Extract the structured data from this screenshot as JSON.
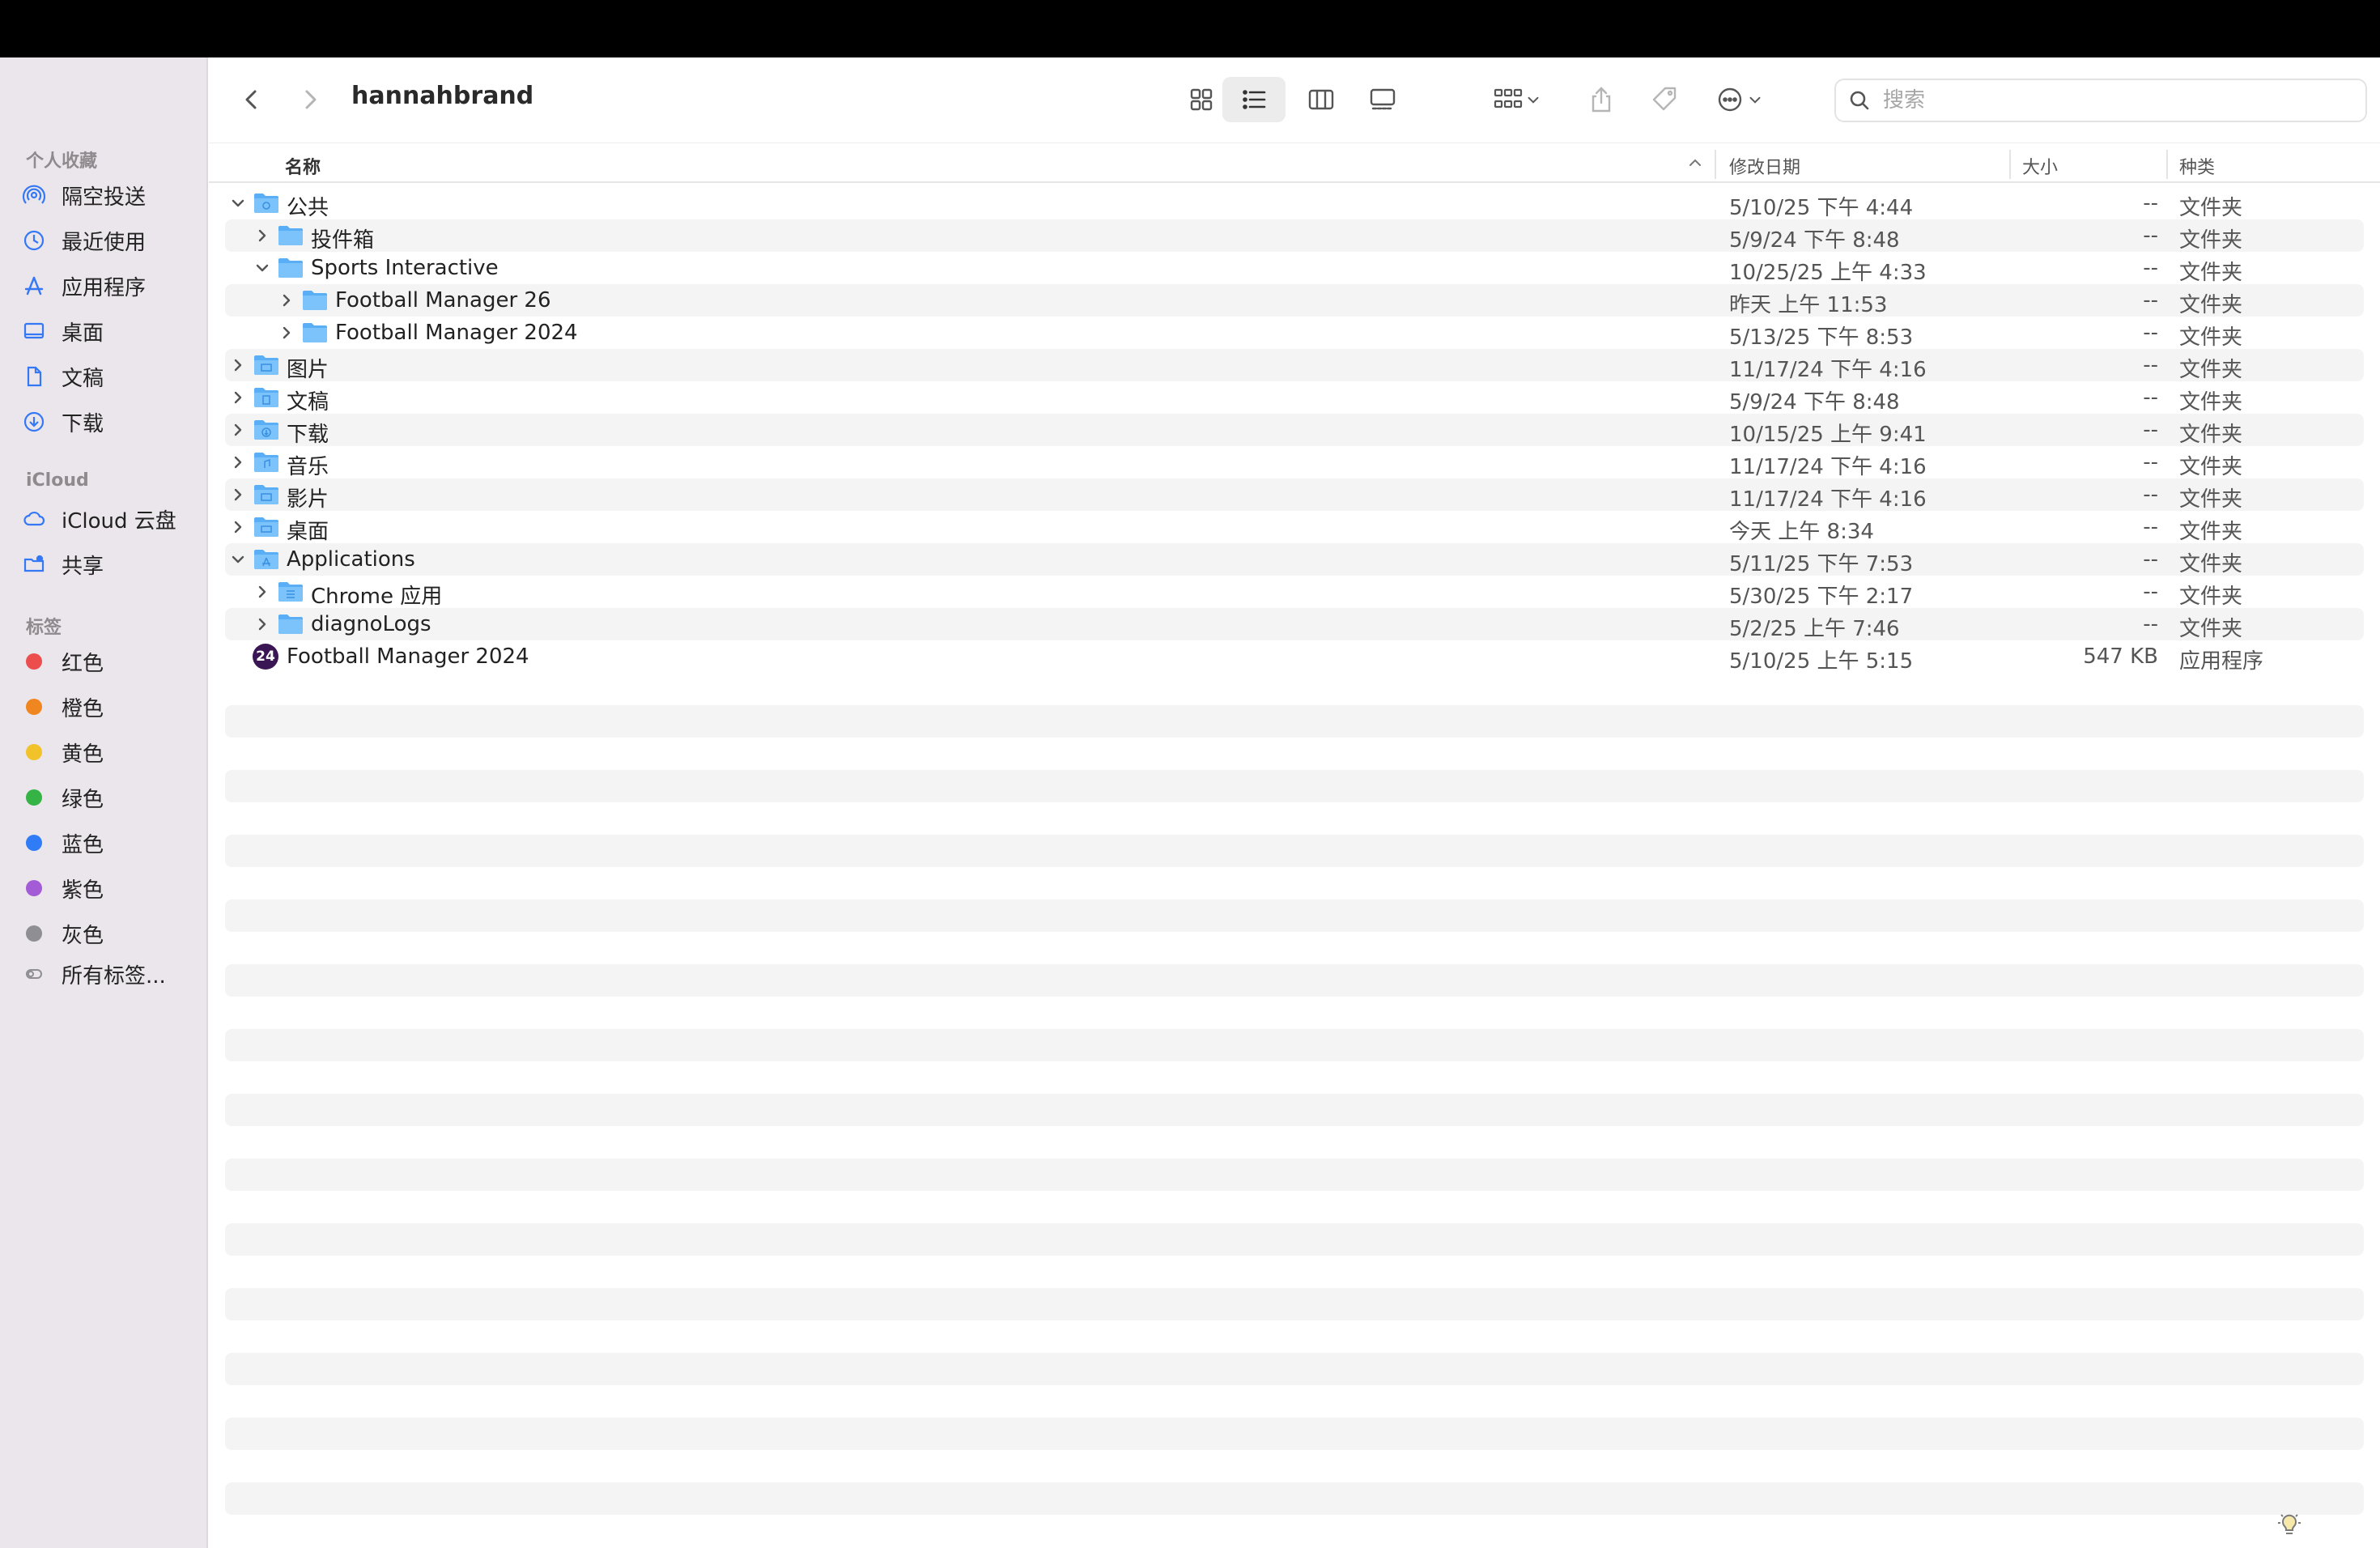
{
  "toolbar": {
    "title": "hannahbrand",
    "search_placeholder": "搜索"
  },
  "sidebar": {
    "favorites_header": "个人收藏",
    "favorites": [
      {
        "label": "隔空投送",
        "icon": "airdrop-icon"
      },
      {
        "label": "最近使用",
        "icon": "recents-clock-icon"
      },
      {
        "label": "应用程序",
        "icon": "applications-icon"
      },
      {
        "label": "桌面",
        "icon": "desktop-icon"
      },
      {
        "label": "文稿",
        "icon": "document-icon"
      },
      {
        "label": "下载",
        "icon": "download-icon"
      }
    ],
    "icloud_header": "iCloud",
    "icloud": [
      {
        "label": "iCloud 云盘",
        "icon": "icloud-icon"
      },
      {
        "label": "共享",
        "icon": "shared-folder-icon"
      }
    ],
    "tags_header": "标签",
    "tags": [
      {
        "label": "红色",
        "color": "#ec4d4d"
      },
      {
        "label": "橙色",
        "color": "#f0861f"
      },
      {
        "label": "黄色",
        "color": "#f2c22a"
      },
      {
        "label": "绿色",
        "color": "#35b445"
      },
      {
        "label": "蓝色",
        "color": "#2f7cf6"
      },
      {
        "label": "紫色",
        "color": "#a45bd6"
      },
      {
        "label": "灰色",
        "color": "#8e8e93"
      }
    ],
    "all_tags": "所有标签..."
  },
  "columns": {
    "name": "名称",
    "date": "修改日期",
    "size": "大小",
    "kind": "种类"
  },
  "rows": [
    {
      "name": "公共",
      "date": "5/10/25 下午 4:44",
      "size": "--",
      "kind": "文件夹",
      "depth": 0,
      "expanded": true,
      "icon": "public-folder-icon"
    },
    {
      "name": "投件箱",
      "date": "5/9/24 下午 8:48",
      "size": "--",
      "kind": "文件夹",
      "depth": 1,
      "expanded": false,
      "icon": "folder-icon"
    },
    {
      "name": "Sports Interactive",
      "date": "10/25/25 上午 4:33",
      "size": "--",
      "kind": "文件夹",
      "depth": 1,
      "expanded": true,
      "icon": "folder-icon"
    },
    {
      "name": "Football Manager 26",
      "date": "昨天 上午 11:53",
      "size": "--",
      "kind": "文件夹",
      "depth": 2,
      "expanded": false,
      "icon": "folder-icon"
    },
    {
      "name": "Football Manager 2024",
      "date": "5/13/25 下午 8:53",
      "size": "--",
      "kind": "文件夹",
      "depth": 2,
      "expanded": false,
      "icon": "folder-icon"
    },
    {
      "name": "图片",
      "date": "11/17/24 下午 4:16",
      "size": "--",
      "kind": "文件夹",
      "depth": 0,
      "expanded": false,
      "icon": "pictures-folder-icon"
    },
    {
      "name": "文稿",
      "date": "5/9/24 下午 8:48",
      "size": "--",
      "kind": "文件夹",
      "depth": 0,
      "expanded": false,
      "icon": "documents-folder-icon"
    },
    {
      "name": "下载",
      "date": "10/15/25 上午 9:41",
      "size": "--",
      "kind": "文件夹",
      "depth": 0,
      "expanded": false,
      "icon": "downloads-folder-icon"
    },
    {
      "name": "音乐",
      "date": "11/17/24 下午 4:16",
      "size": "--",
      "kind": "文件夹",
      "depth": 0,
      "expanded": false,
      "icon": "music-folder-icon"
    },
    {
      "name": "影片",
      "date": "11/17/24 下午 4:16",
      "size": "--",
      "kind": "文件夹",
      "depth": 0,
      "expanded": false,
      "icon": "movies-folder-icon"
    },
    {
      "name": "桌面",
      "date": "今天 上午 8:34",
      "size": "--",
      "kind": "文件夹",
      "depth": 0,
      "expanded": false,
      "icon": "desktop-folder-icon"
    },
    {
      "name": "Applications",
      "date": "5/11/25 下午 7:53",
      "size": "--",
      "kind": "文件夹",
      "depth": 0,
      "expanded": true,
      "icon": "applications-folder-icon"
    },
    {
      "name": "Chrome 应用",
      "date": "5/30/25 下午 2:17",
      "size": "--",
      "kind": "文件夹",
      "depth": 1,
      "expanded": false,
      "icon": "apps-folder-icon"
    },
    {
      "name": "diagnoLogs",
      "date": "5/2/25 上午 7:46",
      "size": "--",
      "kind": "文件夹",
      "depth": 1,
      "expanded": false,
      "icon": "folder-icon"
    },
    {
      "name": "Football Manager 2024",
      "date": "5/10/25 上午 5:15",
      "size": "547 KB",
      "kind": "应用程序",
      "depth": 1,
      "expanded": null,
      "icon": "fm24-app-icon",
      "badge": "24"
    }
  ]
}
